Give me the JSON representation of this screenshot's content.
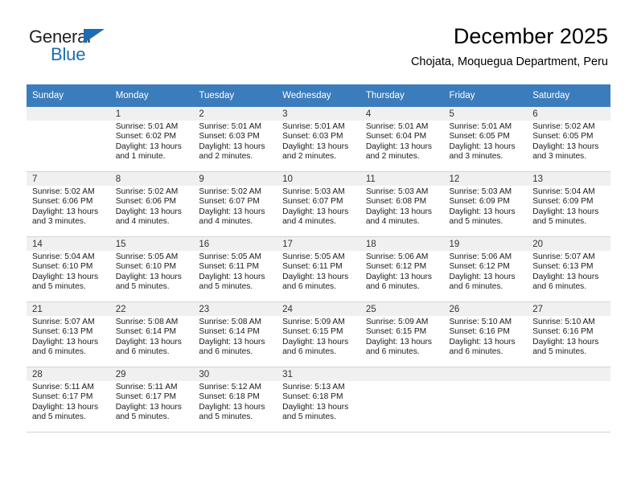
{
  "brand": {
    "name_part1": "General",
    "name_part2": "Blue",
    "triangle_icon": "triangle-icon",
    "accent_color": "#1c6cb3"
  },
  "header": {
    "title": "December 2025",
    "subtitle": "Chojata, Moquegua Department, Peru"
  },
  "calendar": {
    "header_bg": "#3b7cbd",
    "weekday_headers": [
      "Sunday",
      "Monday",
      "Tuesday",
      "Wednesday",
      "Thursday",
      "Friday",
      "Saturday"
    ],
    "weeks": [
      [
        {
          "day": "",
          "sunrise": "",
          "sunset": "",
          "daylight1": "",
          "daylight2": "",
          "empty": true
        },
        {
          "day": "1",
          "sunrise": "Sunrise: 5:01 AM",
          "sunset": "Sunset: 6:02 PM",
          "daylight1": "Daylight: 13 hours",
          "daylight2": "and 1 minute."
        },
        {
          "day": "2",
          "sunrise": "Sunrise: 5:01 AM",
          "sunset": "Sunset: 6:03 PM",
          "daylight1": "Daylight: 13 hours",
          "daylight2": "and 2 minutes."
        },
        {
          "day": "3",
          "sunrise": "Sunrise: 5:01 AM",
          "sunset": "Sunset: 6:03 PM",
          "daylight1": "Daylight: 13 hours",
          "daylight2": "and 2 minutes."
        },
        {
          "day": "4",
          "sunrise": "Sunrise: 5:01 AM",
          "sunset": "Sunset: 6:04 PM",
          "daylight1": "Daylight: 13 hours",
          "daylight2": "and 2 minutes."
        },
        {
          "day": "5",
          "sunrise": "Sunrise: 5:01 AM",
          "sunset": "Sunset: 6:05 PM",
          "daylight1": "Daylight: 13 hours",
          "daylight2": "and 3 minutes."
        },
        {
          "day": "6",
          "sunrise": "Sunrise: 5:02 AM",
          "sunset": "Sunset: 6:05 PM",
          "daylight1": "Daylight: 13 hours",
          "daylight2": "and 3 minutes."
        }
      ],
      [
        {
          "day": "7",
          "sunrise": "Sunrise: 5:02 AM",
          "sunset": "Sunset: 6:06 PM",
          "daylight1": "Daylight: 13 hours",
          "daylight2": "and 3 minutes."
        },
        {
          "day": "8",
          "sunrise": "Sunrise: 5:02 AM",
          "sunset": "Sunset: 6:06 PM",
          "daylight1": "Daylight: 13 hours",
          "daylight2": "and 4 minutes."
        },
        {
          "day": "9",
          "sunrise": "Sunrise: 5:02 AM",
          "sunset": "Sunset: 6:07 PM",
          "daylight1": "Daylight: 13 hours",
          "daylight2": "and 4 minutes."
        },
        {
          "day": "10",
          "sunrise": "Sunrise: 5:03 AM",
          "sunset": "Sunset: 6:07 PM",
          "daylight1": "Daylight: 13 hours",
          "daylight2": "and 4 minutes."
        },
        {
          "day": "11",
          "sunrise": "Sunrise: 5:03 AM",
          "sunset": "Sunset: 6:08 PM",
          "daylight1": "Daylight: 13 hours",
          "daylight2": "and 4 minutes."
        },
        {
          "day": "12",
          "sunrise": "Sunrise: 5:03 AM",
          "sunset": "Sunset: 6:09 PM",
          "daylight1": "Daylight: 13 hours",
          "daylight2": "and 5 minutes."
        },
        {
          "day": "13",
          "sunrise": "Sunrise: 5:04 AM",
          "sunset": "Sunset: 6:09 PM",
          "daylight1": "Daylight: 13 hours",
          "daylight2": "and 5 minutes."
        }
      ],
      [
        {
          "day": "14",
          "sunrise": "Sunrise: 5:04 AM",
          "sunset": "Sunset: 6:10 PM",
          "daylight1": "Daylight: 13 hours",
          "daylight2": "and 5 minutes."
        },
        {
          "day": "15",
          "sunrise": "Sunrise: 5:05 AM",
          "sunset": "Sunset: 6:10 PM",
          "daylight1": "Daylight: 13 hours",
          "daylight2": "and 5 minutes."
        },
        {
          "day": "16",
          "sunrise": "Sunrise: 5:05 AM",
          "sunset": "Sunset: 6:11 PM",
          "daylight1": "Daylight: 13 hours",
          "daylight2": "and 5 minutes."
        },
        {
          "day": "17",
          "sunrise": "Sunrise: 5:05 AM",
          "sunset": "Sunset: 6:11 PM",
          "daylight1": "Daylight: 13 hours",
          "daylight2": "and 6 minutes."
        },
        {
          "day": "18",
          "sunrise": "Sunrise: 5:06 AM",
          "sunset": "Sunset: 6:12 PM",
          "daylight1": "Daylight: 13 hours",
          "daylight2": "and 6 minutes."
        },
        {
          "day": "19",
          "sunrise": "Sunrise: 5:06 AM",
          "sunset": "Sunset: 6:12 PM",
          "daylight1": "Daylight: 13 hours",
          "daylight2": "and 6 minutes."
        },
        {
          "day": "20",
          "sunrise": "Sunrise: 5:07 AM",
          "sunset": "Sunset: 6:13 PM",
          "daylight1": "Daylight: 13 hours",
          "daylight2": "and 6 minutes."
        }
      ],
      [
        {
          "day": "21",
          "sunrise": "Sunrise: 5:07 AM",
          "sunset": "Sunset: 6:13 PM",
          "daylight1": "Daylight: 13 hours",
          "daylight2": "and 6 minutes."
        },
        {
          "day": "22",
          "sunrise": "Sunrise: 5:08 AM",
          "sunset": "Sunset: 6:14 PM",
          "daylight1": "Daylight: 13 hours",
          "daylight2": "and 6 minutes."
        },
        {
          "day": "23",
          "sunrise": "Sunrise: 5:08 AM",
          "sunset": "Sunset: 6:14 PM",
          "daylight1": "Daylight: 13 hours",
          "daylight2": "and 6 minutes."
        },
        {
          "day": "24",
          "sunrise": "Sunrise: 5:09 AM",
          "sunset": "Sunset: 6:15 PM",
          "daylight1": "Daylight: 13 hours",
          "daylight2": "and 6 minutes."
        },
        {
          "day": "25",
          "sunrise": "Sunrise: 5:09 AM",
          "sunset": "Sunset: 6:15 PM",
          "daylight1": "Daylight: 13 hours",
          "daylight2": "and 6 minutes."
        },
        {
          "day": "26",
          "sunrise": "Sunrise: 5:10 AM",
          "sunset": "Sunset: 6:16 PM",
          "daylight1": "Daylight: 13 hours",
          "daylight2": "and 6 minutes."
        },
        {
          "day": "27",
          "sunrise": "Sunrise: 5:10 AM",
          "sunset": "Sunset: 6:16 PM",
          "daylight1": "Daylight: 13 hours",
          "daylight2": "and 5 minutes."
        }
      ],
      [
        {
          "day": "28",
          "sunrise": "Sunrise: 5:11 AM",
          "sunset": "Sunset: 6:17 PM",
          "daylight1": "Daylight: 13 hours",
          "daylight2": "and 5 minutes."
        },
        {
          "day": "29",
          "sunrise": "Sunrise: 5:11 AM",
          "sunset": "Sunset: 6:17 PM",
          "daylight1": "Daylight: 13 hours",
          "daylight2": "and 5 minutes."
        },
        {
          "day": "30",
          "sunrise": "Sunrise: 5:12 AM",
          "sunset": "Sunset: 6:18 PM",
          "daylight1": "Daylight: 13 hours",
          "daylight2": "and 5 minutes."
        },
        {
          "day": "31",
          "sunrise": "Sunrise: 5:13 AM",
          "sunset": "Sunset: 6:18 PM",
          "daylight1": "Daylight: 13 hours",
          "daylight2": "and 5 minutes."
        },
        {
          "day": "",
          "sunrise": "",
          "sunset": "",
          "daylight1": "",
          "daylight2": "",
          "empty": true
        },
        {
          "day": "",
          "sunrise": "",
          "sunset": "",
          "daylight1": "",
          "daylight2": "",
          "empty": true
        },
        {
          "day": "",
          "sunrise": "",
          "sunset": "",
          "daylight1": "",
          "daylight2": "",
          "empty": true
        }
      ]
    ]
  }
}
